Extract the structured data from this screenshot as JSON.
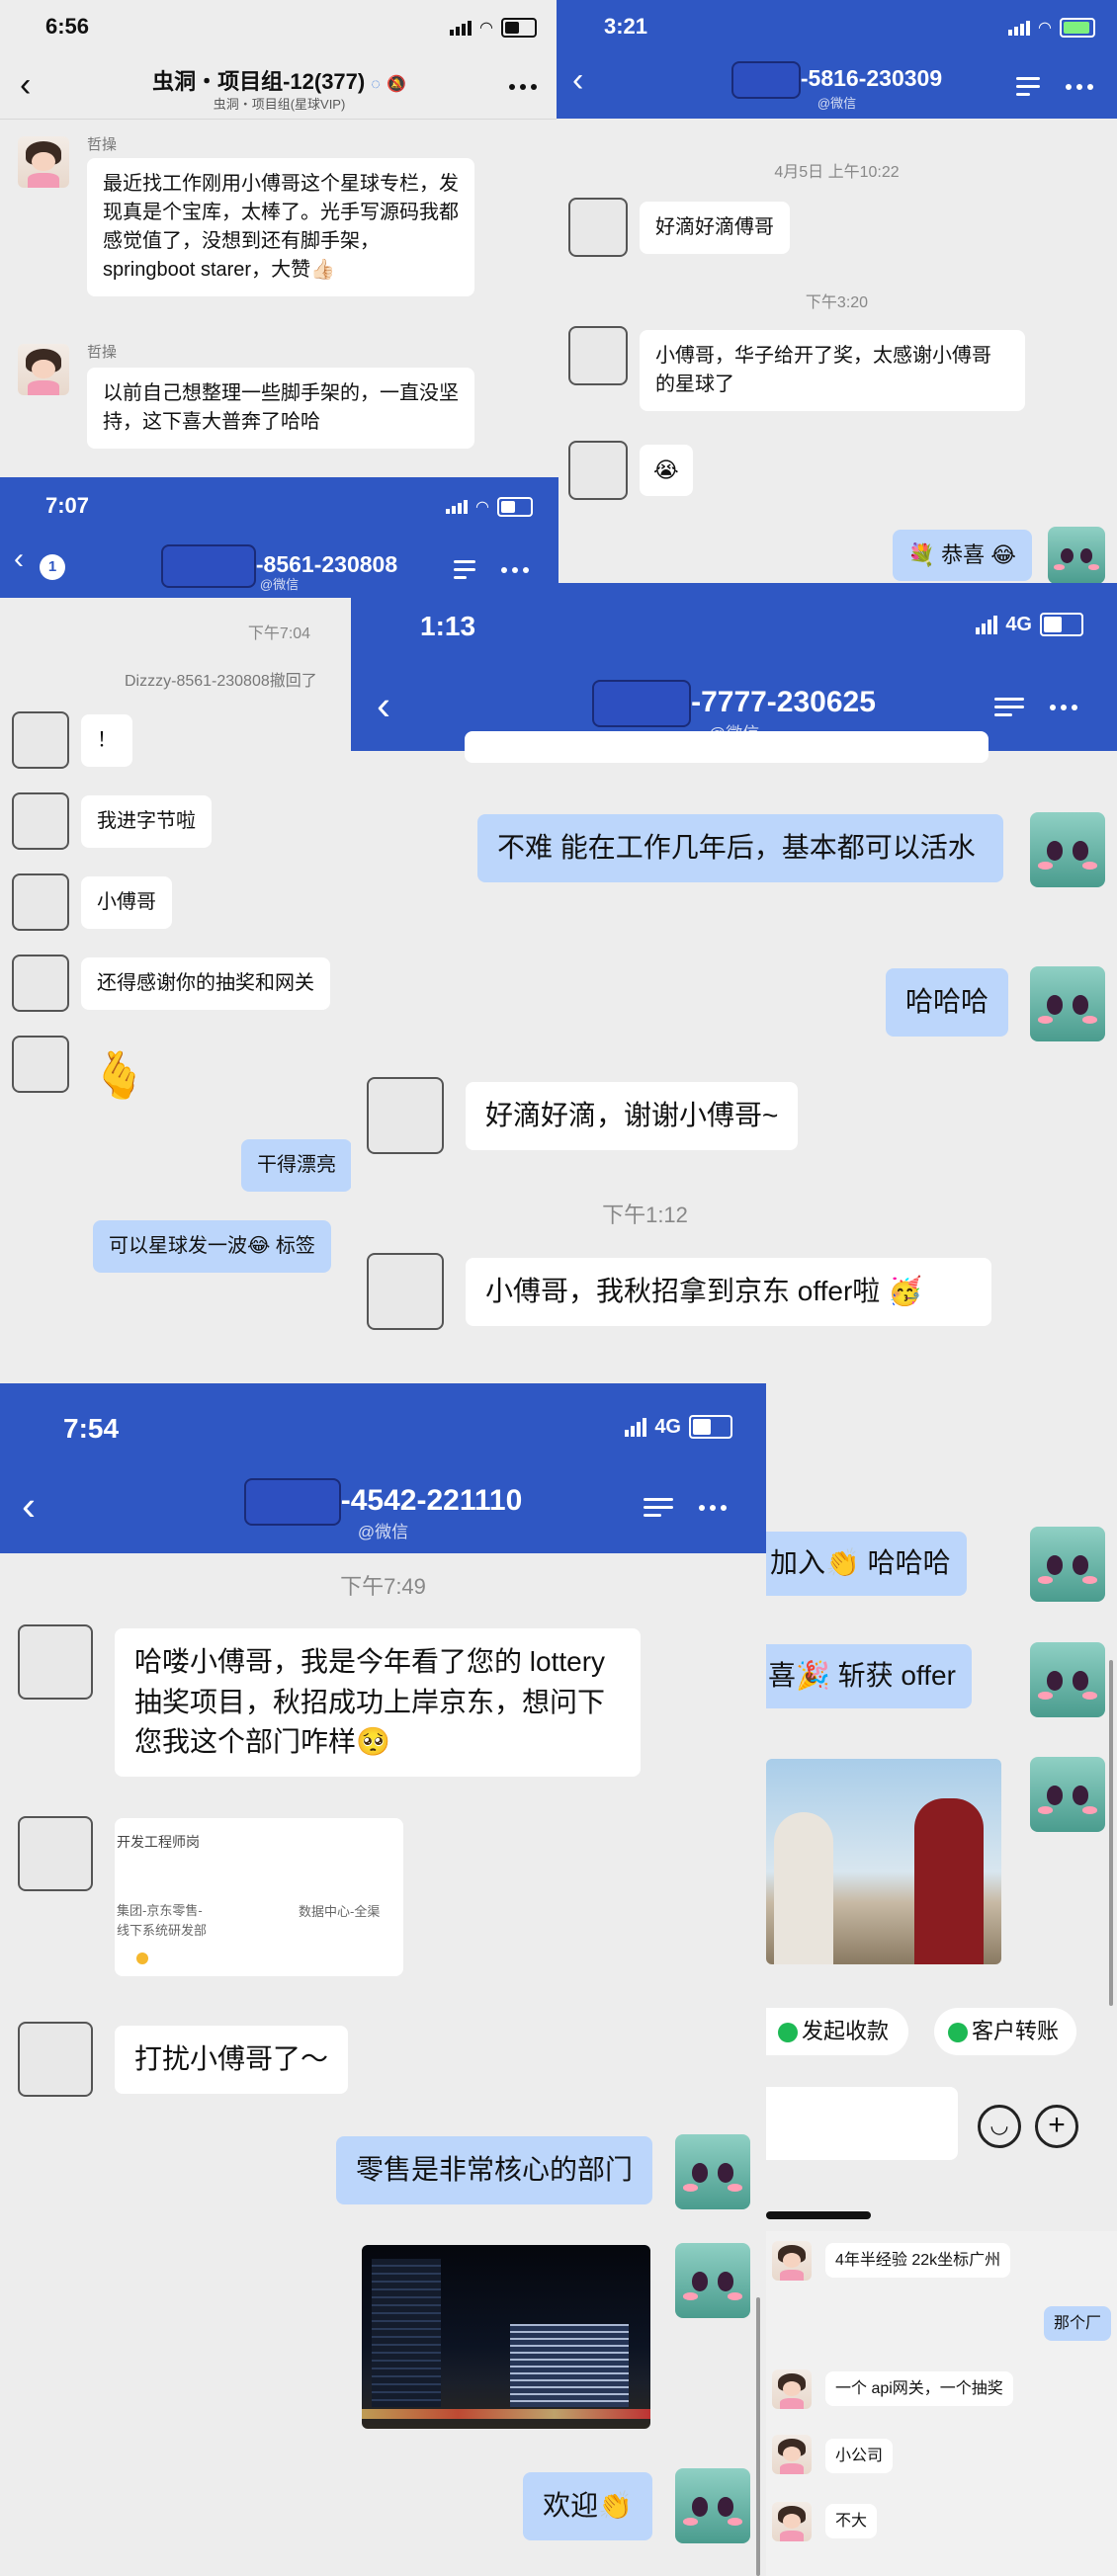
{
  "panel1": {
    "time": "6:56",
    "group_title": "虫洞・项目组-12(377)",
    "group_subtitle": "虫洞・项目组(星球VIP)",
    "messages": [
      {
        "sender": "哲操",
        "text": "最近找工作刚用小傅哥这个星球专栏，发现真是个宝库，太棒了。光手写源码我都感觉值了，没想到还有脚手架，springboot starer，大赞👍🏻"
      },
      {
        "sender": "哲操",
        "text": "以前自己想整理一些脚手架的，一直没坚持，这下喜大普奔了哈哈"
      }
    ]
  },
  "panel2": {
    "time": "3:21",
    "contact_suffix": "-5816-230309",
    "contact_source": "@微信",
    "ts1": "4月5日 上午10:22",
    "msg1": "好滴好滴傅哥",
    "ts2": "下午3:20",
    "msg2": "小傅哥，华子给开了奖，太感谢小傅哥的星球了",
    "msg3": "😭",
    "msg4": "💐 恭喜 😂"
  },
  "panel3": {
    "time": "7:07",
    "back_badge": "1",
    "contact_suffix": "-8561-230808",
    "contact_source": "@微信",
    "ts": "下午7:04",
    "recall": "Dizzzy-8561-230808撤回了",
    "m1": "！",
    "m2": "我进字节啦",
    "m3": "小傅哥",
    "m4": "还得感谢你的抽奖和网关",
    "m5": "🫰",
    "m6": "干得漂亮",
    "m7": "可以星球发一波😂 标签"
  },
  "panel4": {
    "time": "1:13",
    "network": "4G",
    "contact_suffix": "-7777-230625",
    "contact_source": "@微信",
    "m1": "不难 能在工作几年后，基本都可以活水",
    "m2": "哈哈哈",
    "m3": "好滴好滴，谢谢小傅哥~",
    "ts": "下午1:12",
    "m4": "小傅哥，我秋招拿到京东 offer啦 🥳"
  },
  "panel5": {
    "m1": "加入👏 哈哈哈",
    "m2": "喜🎉 斩获 offer",
    "action1": "发起收款",
    "action2": "客户转账"
  },
  "panel6": {
    "m1": "4年半经验 22k坐标广州",
    "m2": "那个厂",
    "m3": "一个 api网关，一个抽奖",
    "m4": "小公司",
    "m5": "不大"
  },
  "panel7": {
    "time": "7:54",
    "network": "4G",
    "contact_suffix": "-4542-221110",
    "contact_source": "@微信",
    "ts": "下午7:49",
    "m1": "哈喽小傅哥，我是今年看了您的 lottery抽奖项目，秋招成功上岸京东，想问下您我这个部门咋样🥺",
    "card_title": "开发工程师岗",
    "card_left": "集团-京东零售-\n线下系统研发部",
    "card_right": "数据中心-全渠",
    "m2": "打扰小傅哥了～",
    "m3": "零售是非常核心的部门",
    "m4": "欢迎👏"
  },
  "colors": {
    "header_blue": "#2f57c3",
    "bubble_blue": "#bcd6fb",
    "bg": "#ededed"
  }
}
